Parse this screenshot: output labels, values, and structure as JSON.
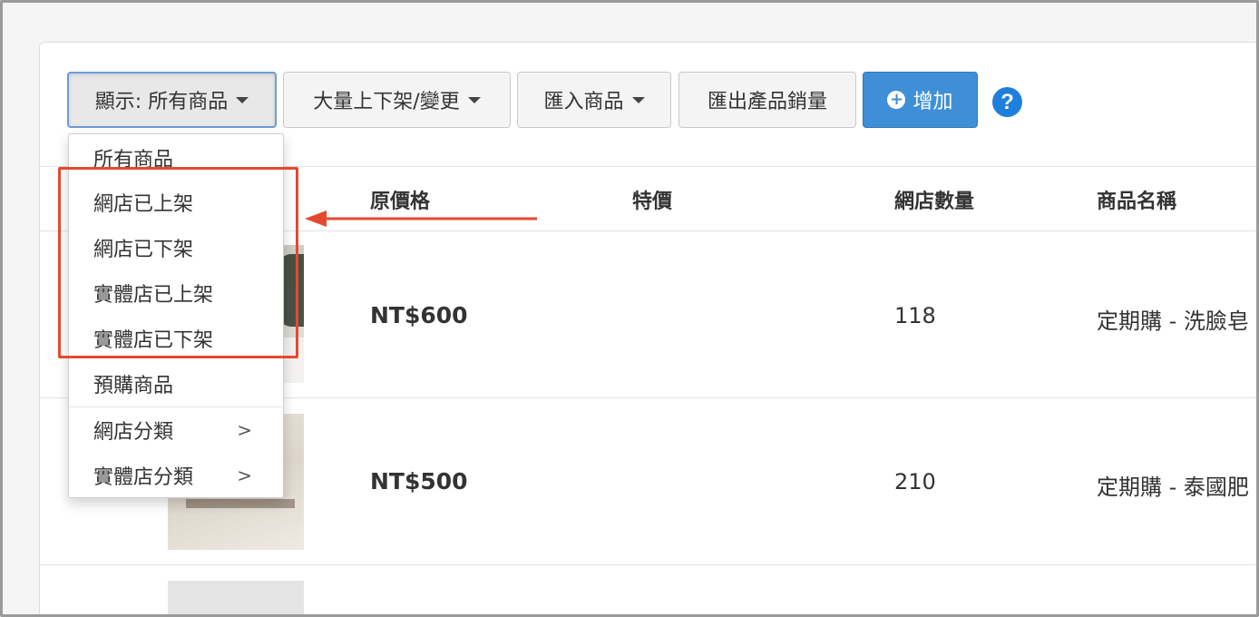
{
  "toolbar": {
    "display_filter_label": "顯示: 所有商品",
    "bulk_label": "大量上下架/變更",
    "import_label": "匯入商品",
    "export_label": "匯出產品銷量",
    "add_label": "增加",
    "help_glyph": "?"
  },
  "table": {
    "headers": [
      "原價格",
      "特價",
      "網店數量",
      "商品名稱"
    ],
    "rows": [
      {
        "price": "NT$600",
        "sale_price": "",
        "stock": "118",
        "name": "定期購 - 洗臉皂"
      },
      {
        "price": "NT$500",
        "sale_price": "",
        "stock": "210",
        "name": "定期購 - 泰國肥"
      }
    ]
  },
  "dropdown": {
    "items": [
      {
        "label": "所有商品",
        "has_submenu": false
      },
      {
        "label": "網店已上架",
        "has_submenu": false
      },
      {
        "label": "網店已下架",
        "has_submenu": false
      },
      {
        "label": "實體店已上架",
        "has_submenu": false
      },
      {
        "label": "實體店已下架",
        "has_submenu": false
      },
      {
        "label": "預購商品",
        "has_submenu": false
      },
      {
        "label": "網店分類",
        "has_submenu": true
      },
      {
        "label": "實體店分類",
        "has_submenu": true
      }
    ],
    "submenu_glyph": ">"
  },
  "annotation": {
    "color": "#e4492f"
  },
  "colors": {
    "primary": "#3f8fd8",
    "help": "#1f7fdd"
  }
}
